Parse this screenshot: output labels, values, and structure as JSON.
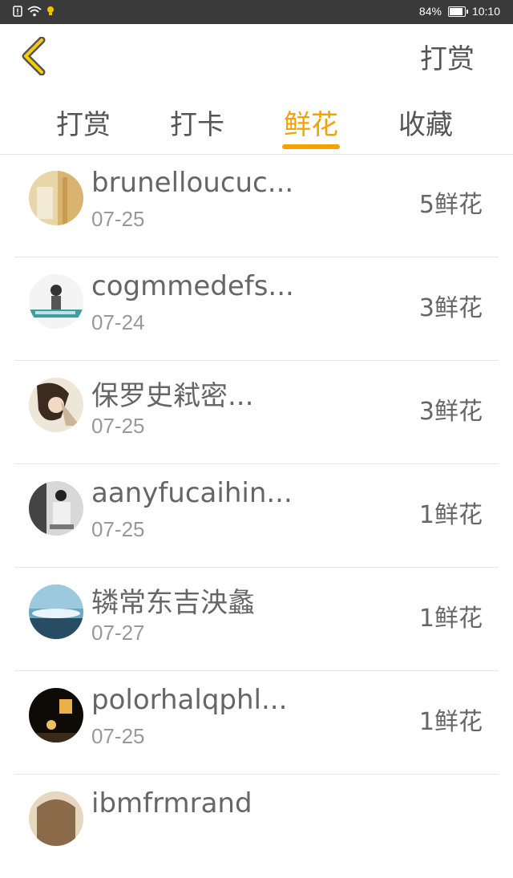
{
  "status_bar": {
    "battery": "84%",
    "time": "10:10"
  },
  "header": {
    "title": "打赏"
  },
  "tabs": [
    {
      "label": "打赏",
      "active": false
    },
    {
      "label": "打卡",
      "active": false
    },
    {
      "label": "鲜花",
      "active": true
    },
    {
      "label": "收藏",
      "active": false
    }
  ],
  "list": [
    {
      "name": "brunelloucuc...",
      "date": "07-25",
      "amount": "5鲜花"
    },
    {
      "name": "cogmmedefs...",
      "date": "07-24",
      "amount": "3鲜花"
    },
    {
      "name": "保罗史弒密...",
      "date": "07-25",
      "amount": "3鲜花"
    },
    {
      "name": "aanyfucaihin...",
      "date": "07-25",
      "amount": "1鲜花"
    },
    {
      "name": "辚常东吉泱蠡",
      "date": "07-27",
      "amount": "1鲜花"
    },
    {
      "name": "polorhalqphl...",
      "date": "07-25",
      "amount": "1鲜花"
    },
    {
      "name": "ibmfrmrand",
      "date": "",
      "amount": ""
    }
  ],
  "colors": {
    "accent": "#f5a100",
    "status_bar": "#3a3a3a"
  }
}
